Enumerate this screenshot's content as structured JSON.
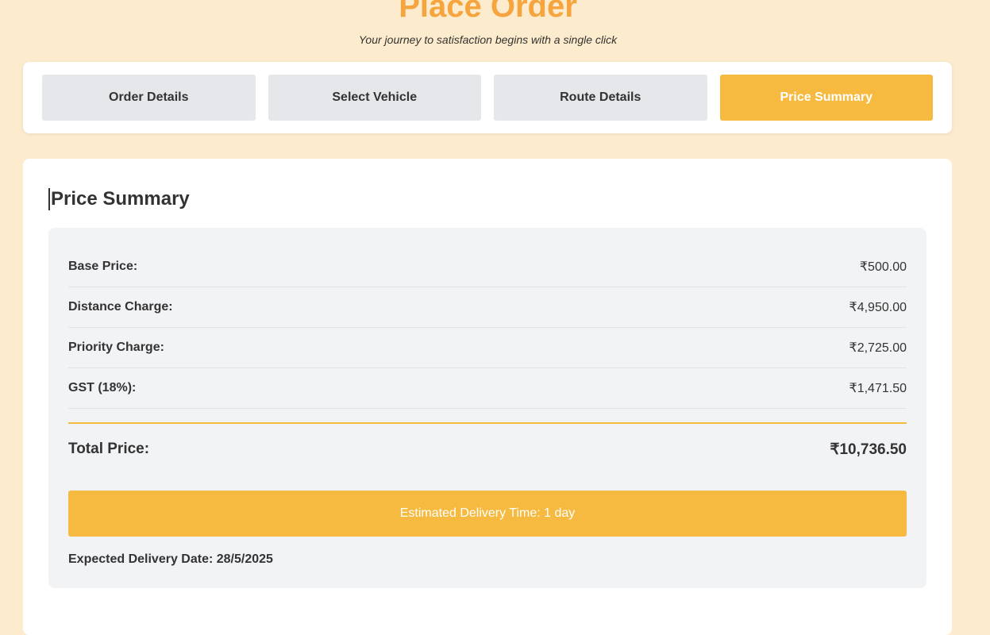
{
  "header": {
    "title": "Place Order",
    "subtitle": "Your journey to satisfaction begins with a single click"
  },
  "steps": [
    {
      "label": "Order Details"
    },
    {
      "label": "Select Vehicle"
    },
    {
      "label": "Route Details"
    },
    {
      "label": "Price Summary",
      "active": true
    }
  ],
  "summary": {
    "heading": "Price Summary",
    "rows": [
      {
        "label": "Base Price:",
        "value": "₹500.00"
      },
      {
        "label": "Distance Charge:",
        "value": "₹4,950.00"
      },
      {
        "label": "Priority Charge:",
        "value": "₹2,725.00"
      },
      {
        "label": "GST (18%):",
        "value": "₹1,471.50"
      }
    ],
    "total_label": "Total Price:",
    "total_value": "₹10,736.50",
    "estimated": "Estimated Delivery Time: 1 day",
    "expected": "Expected Delivery Date: 28/5/2025"
  },
  "colors": {
    "accent": "#f5ba3f",
    "title": "#f5a43e",
    "background": "#fcebcc"
  }
}
